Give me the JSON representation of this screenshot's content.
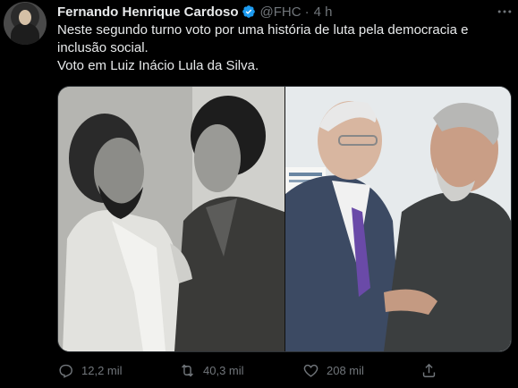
{
  "tweet": {
    "author_name": "Fernando Henrique Cardoso",
    "handle": "@FHC",
    "separator": "·",
    "time": "4 h",
    "text_line_1": "Neste segundo turno voto por uma história de luta pela democracia e",
    "text_line_2": "inclusão social.",
    "text_line_3": "Voto em Luiz Inácio Lula da Silva."
  },
  "actions": {
    "reply": {
      "icon": "reply-icon",
      "count": "12,2 mil"
    },
    "retweet": {
      "icon": "retweet-icon",
      "count": "40,3 mil"
    },
    "like": {
      "icon": "heart-icon",
      "count": "208 mil"
    },
    "share": {
      "icon": "share-icon"
    }
  },
  "colors": {
    "background": "#000000",
    "text": "#e7e9ea",
    "secondary": "#71767b",
    "verified": "#1d9bf0"
  }
}
